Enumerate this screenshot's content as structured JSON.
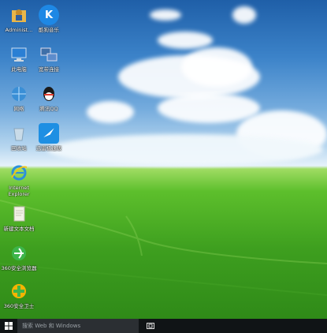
{
  "desktop_icons": [
    {
      "label": "Administ...",
      "icon": "user-folder-icon",
      "color": "#d9a42b"
    },
    {
      "label": "酷狗音乐",
      "icon": "kugou-music-icon",
      "color": "#1e88e5"
    },
    {
      "label": "此电脑",
      "icon": "this-pc-icon",
      "color": "#2a7fd4"
    },
    {
      "label": "宽带连接",
      "icon": "broadband-icon",
      "color": "#3f6fa8"
    },
    {
      "label": "网络",
      "icon": "network-icon",
      "color": "#3a8fd6"
    },
    {
      "label": "腾讯QQ",
      "icon": "qq-icon",
      "color": "#1a1a1a"
    },
    {
      "label": "回收站",
      "icon": "recycle-bin-icon",
      "color": "#9fb7c9"
    },
    {
      "label": "迅雷极速版",
      "icon": "thunder-icon",
      "color": "#1e8fe3"
    },
    {
      "label": "Internet Explorer",
      "icon": "internet-explorer-icon",
      "color": "#2b8fdc"
    },
    {
      "label": "新建文本文档",
      "icon": "text-document-icon",
      "color": "#f2f2e6"
    },
    {
      "label": "360安全浏览器",
      "icon": "360-browser-icon",
      "color": "#3db54a"
    },
    {
      "label": "360安全卫士",
      "icon": "360-security-icon",
      "color": "#f5b400"
    }
  ],
  "taskbar": {
    "start_icon": "windows-logo-icon",
    "search_placeholder": "搜索 Web 和 Windows",
    "task_view_icon": "task-view-icon"
  }
}
